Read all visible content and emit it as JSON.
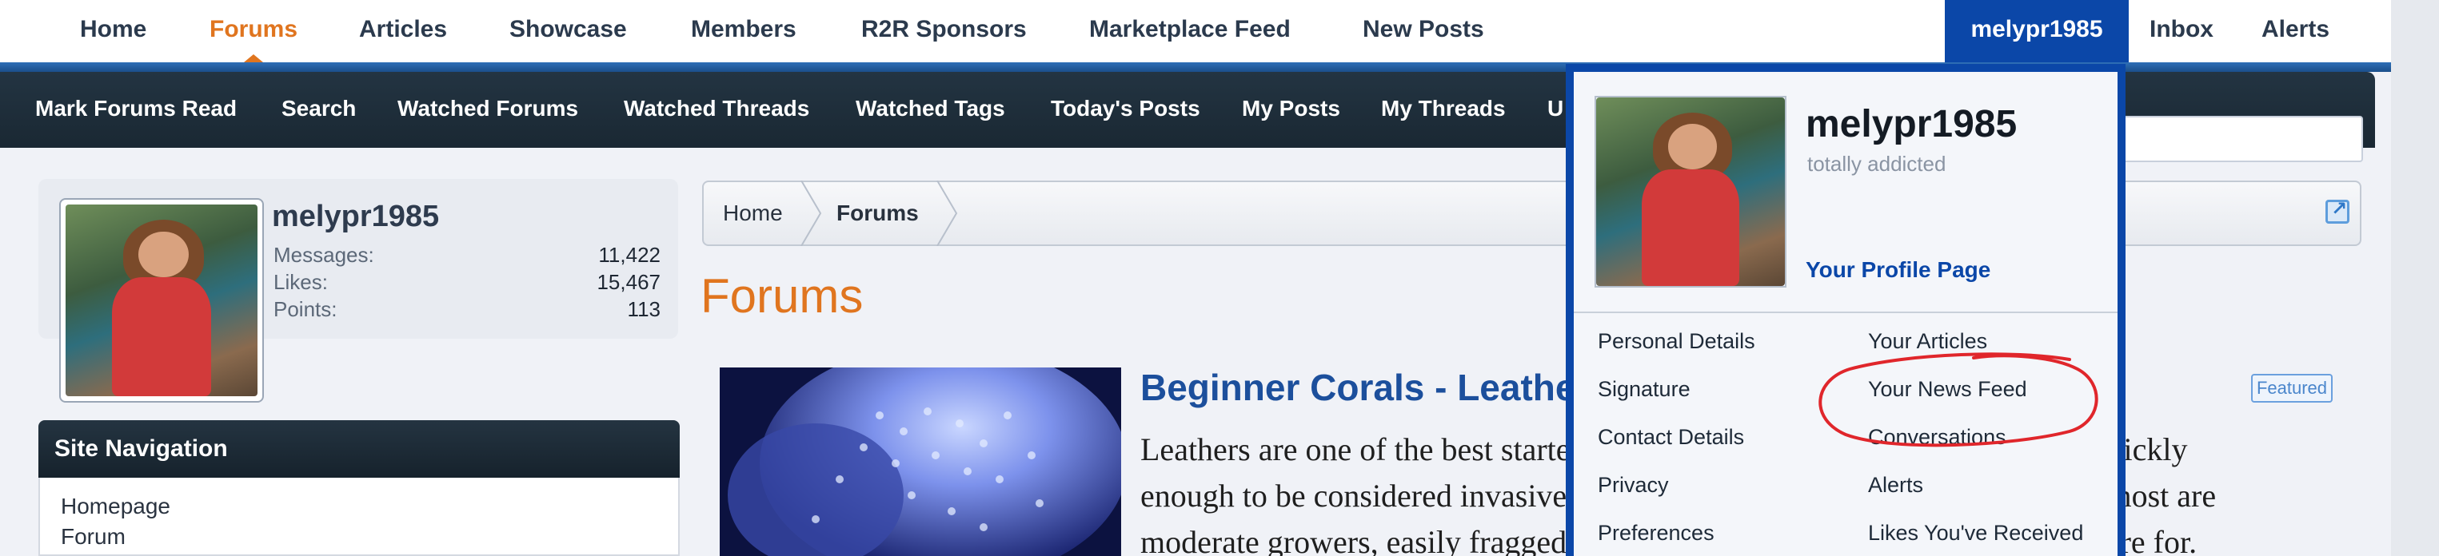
{
  "top_nav": {
    "items": [
      "Home",
      "Forums",
      "Articles",
      "Showcase",
      "Members",
      "R2R Sponsors",
      "Marketplace Feed",
      "New Posts"
    ],
    "active": "Forums",
    "user_tab": "melypr1985",
    "right_items": [
      "Inbox",
      "Alerts"
    ]
  },
  "sub_nav": {
    "items": [
      "Mark Forums Read",
      "Search",
      "Watched Forums",
      "Watched Threads",
      "Watched Tags",
      "Today's Posts",
      "My Posts",
      "My Threads",
      "U"
    ]
  },
  "sidebar": {
    "username": "melypr1985",
    "stats": [
      {
        "label": "Messages:",
        "value": "11,422"
      },
      {
        "label": "Likes:",
        "value": "15,467"
      },
      {
        "label": "Points:",
        "value": "113"
      }
    ],
    "site_nav_title": "Site Navigation",
    "site_nav_links": [
      "Homepage",
      "Forum"
    ]
  },
  "breadcrumb": [
    "Home",
    "Forums"
  ],
  "page_title": "Forums",
  "article": {
    "title": "Beginner Corals - Leathers",
    "badge": "Featured",
    "lines": [
      "Leathers are one of the best starter corals around. Some of them can grow quickly",
      "enough to be considered invasive (the Kenya tree comes to mind here), but most are",
      "moderate growers, easily fragged and won't break the bank to purchase or care for."
    ]
  },
  "dropdown": {
    "username": "melypr1985",
    "user_title": "totally addicted",
    "profile_link": "Your Profile Page",
    "left_links": [
      "Personal Details",
      "Signature",
      "Contact Details",
      "Privacy",
      "Preferences"
    ],
    "right_links": [
      "Your Articles",
      "Your News Feed",
      "Conversations",
      "Alerts",
      "Likes You've Received"
    ]
  },
  "colors": {
    "accent_orange": "#e0751f",
    "brand_blue": "#0b47a8",
    "dark_bar": "#1d2b37",
    "annotation_red": "#e0262b"
  }
}
